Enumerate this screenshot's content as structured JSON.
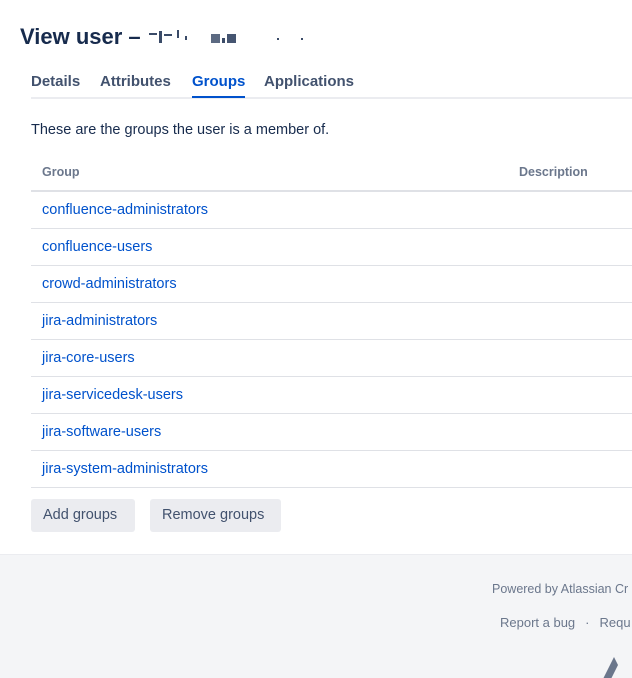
{
  "header": {
    "title_prefix": "View user – ",
    "title_name_partial": "s   l    n.a"
  },
  "tabs": [
    {
      "label": "Details",
      "active": false
    },
    {
      "label": "Attributes",
      "active": false
    },
    {
      "label": "Groups",
      "active": true
    },
    {
      "label": "Applications",
      "active": false
    }
  ],
  "main": {
    "intro": "These are the groups the user is a member of.",
    "table": {
      "columns": [
        "Group",
        "Description"
      ],
      "rows": [
        {
          "group": "confluence-administrators",
          "description": ""
        },
        {
          "group": "confluence-users",
          "description": ""
        },
        {
          "group": "crowd-administrators",
          "description": ""
        },
        {
          "group": "jira-administrators",
          "description": ""
        },
        {
          "group": "jira-core-users",
          "description": ""
        },
        {
          "group": "jira-servicedesk-users",
          "description": ""
        },
        {
          "group": "jira-software-users",
          "description": ""
        },
        {
          "group": "jira-system-administrators",
          "description": ""
        }
      ]
    },
    "buttons": {
      "add": "Add groups",
      "remove": "Remove groups"
    }
  },
  "footer": {
    "powered": "Powered by Atlassian Cr",
    "report_bug": "Report a bug",
    "separator": "·",
    "request": "Requ"
  },
  "colors": {
    "link": "#0052cc",
    "text": "#172b4d",
    "muted": "#6b778c",
    "button_bg": "#ebecf0",
    "footer_bg": "#f4f5f7"
  }
}
